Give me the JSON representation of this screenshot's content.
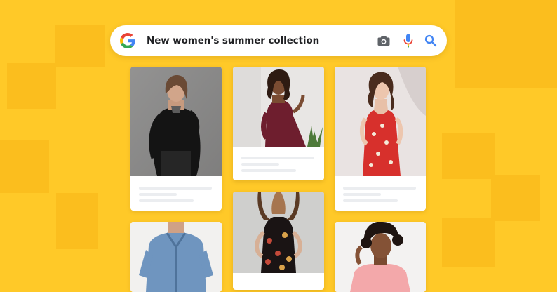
{
  "search": {
    "query": "New women's summer collection",
    "logo_icon": "google-g-logo-icon",
    "camera_icon": "camera-icon",
    "mic_icon": "microphone-icon",
    "search_icon": "magnifier-search-icon"
  },
  "colors": {
    "background": "#FFC928",
    "google_blue": "#4285F4",
    "google_red": "#EA4335",
    "google_yellow": "#FBBC05",
    "google_green": "#34A853"
  },
  "results": [
    {
      "subject": "woman in black turtleneck dress",
      "placeholder_lines": 3
    },
    {
      "subject": "woman in burgundy dress",
      "placeholder_lines": 3
    },
    {
      "subject": "woman in red floral slip dress",
      "placeholder_lines": 3
    },
    {
      "subject": "woman in denim shirt dress",
      "placeholder_lines": 0
    },
    {
      "subject": "woman in black floral dress",
      "placeholder_lines": 0
    },
    {
      "subject": "woman in pink top",
      "placeholder_lines": 0
    }
  ]
}
